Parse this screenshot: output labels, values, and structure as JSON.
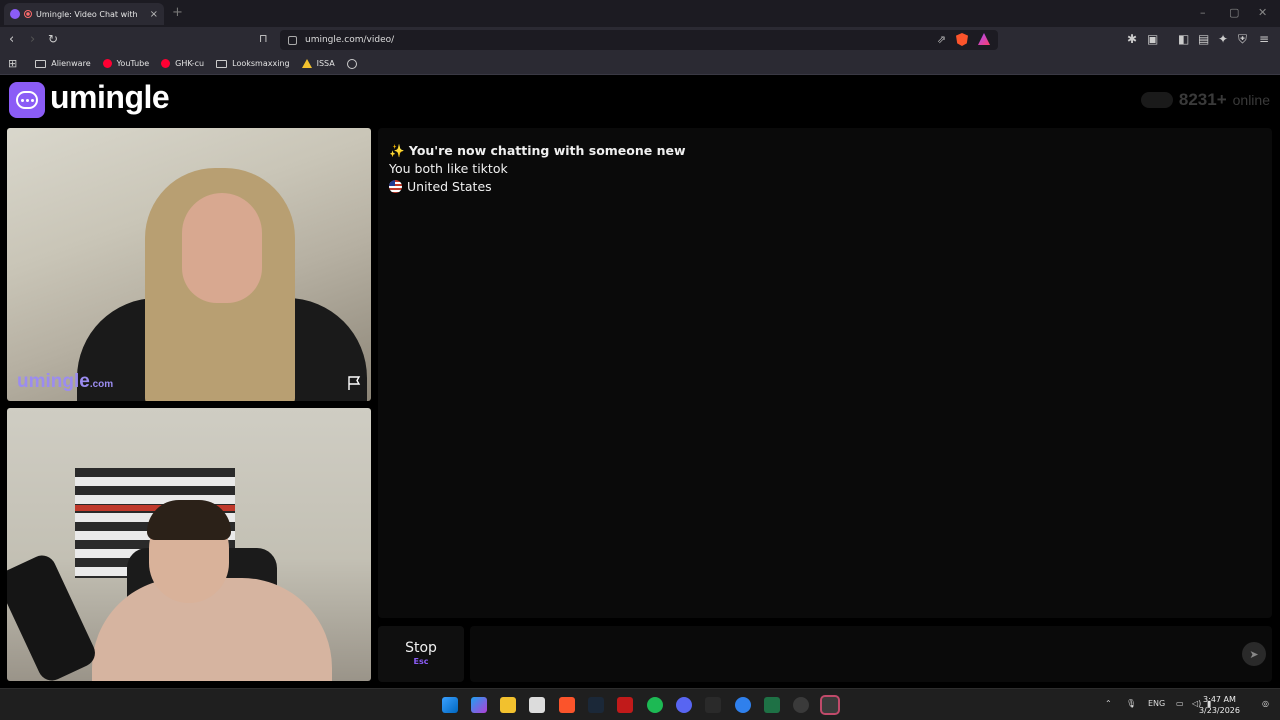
{
  "browser": {
    "tab_title": "Umingle: Video Chat with Stra",
    "url": "umingle.com/video/",
    "bookmarks": [
      "Alienware",
      "YouTube",
      "GHK-cu",
      "Looksmaxxing",
      "ISSA"
    ]
  },
  "site": {
    "logo_text": "umingle",
    "online_count": "8231+",
    "online_label": "online",
    "watermark_main": "umingle",
    "watermark_suffix": ".com"
  },
  "chat": {
    "headline": "✨ You're now chatting with someone new",
    "common_interest": "You both like tiktok",
    "country": "United States"
  },
  "controls": {
    "stop_label": "Stop",
    "stop_key": "Esc"
  },
  "taskbar": {
    "language": "ENG",
    "time": "3:47 AM",
    "date": "3/23/2026"
  },
  "colors": {
    "brand": "#8b5cf6",
    "background": "#000000",
    "panel": "#0a0a0a"
  }
}
